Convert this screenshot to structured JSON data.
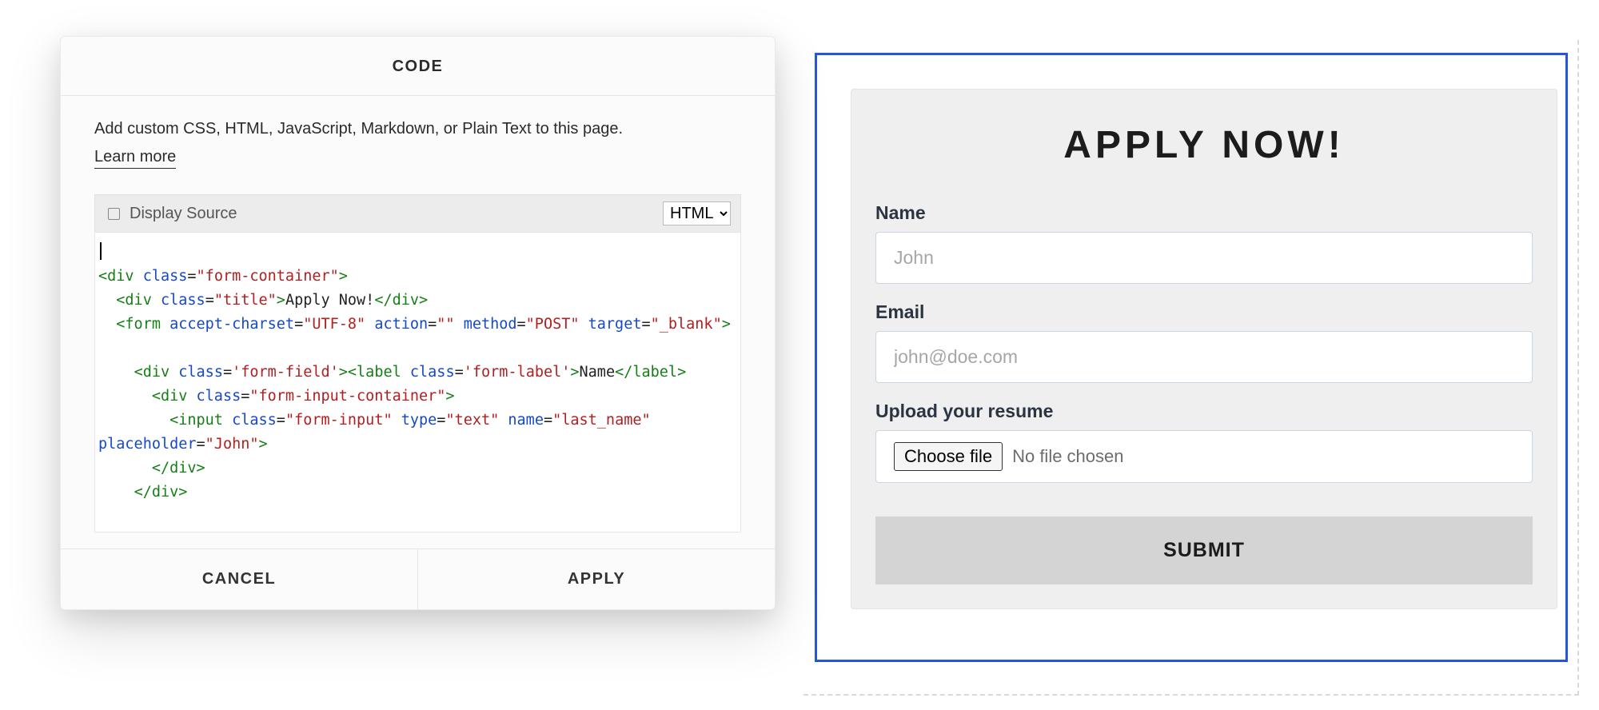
{
  "dialog": {
    "title": "CODE",
    "description": "Add custom CSS, HTML, JavaScript, Markdown, or Plain Text to this page.",
    "learn_more": "Learn more",
    "display_source_label": "Display Source",
    "language_selected": "HTML",
    "cancel_label": "CANCEL",
    "apply_label": "APPLY",
    "code_tokens": {
      "div": "div",
      "form": "form",
      "label": "label",
      "input": "input",
      "class": "class",
      "accept_charset": "accept-charset",
      "action": "action",
      "method": "method",
      "target": "target",
      "type": "type",
      "name_attr": "name",
      "placeholder": "placeholder",
      "v_form_container": "\"form-container\"",
      "v_title": "\"title\"",
      "v_utf8": "\"UTF-8\"",
      "v_empty": "\"\"",
      "v_post": "\"POST\"",
      "v_blank": "\"_blank\"",
      "v_form_field": "'form-field'",
      "v_form_label": "'form-label'",
      "v_form_input_container": "\"form-input-container\"",
      "v_form_input": "\"form-input\"",
      "v_text": "\"text\"",
      "v_last_name": "\"last_name\"",
      "v_john": "\"John\"",
      "txt_apply_now": "Apply Now!",
      "txt_name": "Name"
    }
  },
  "preview": {
    "form_title": "APPLY NOW!",
    "name_label": "Name",
    "name_placeholder": "John",
    "email_label": "Email",
    "email_placeholder": "john@doe.com",
    "upload_label": "Upload your resume",
    "choose_file_label": "Choose file",
    "file_status": "No file chosen",
    "submit_label": "SUBMIT"
  }
}
